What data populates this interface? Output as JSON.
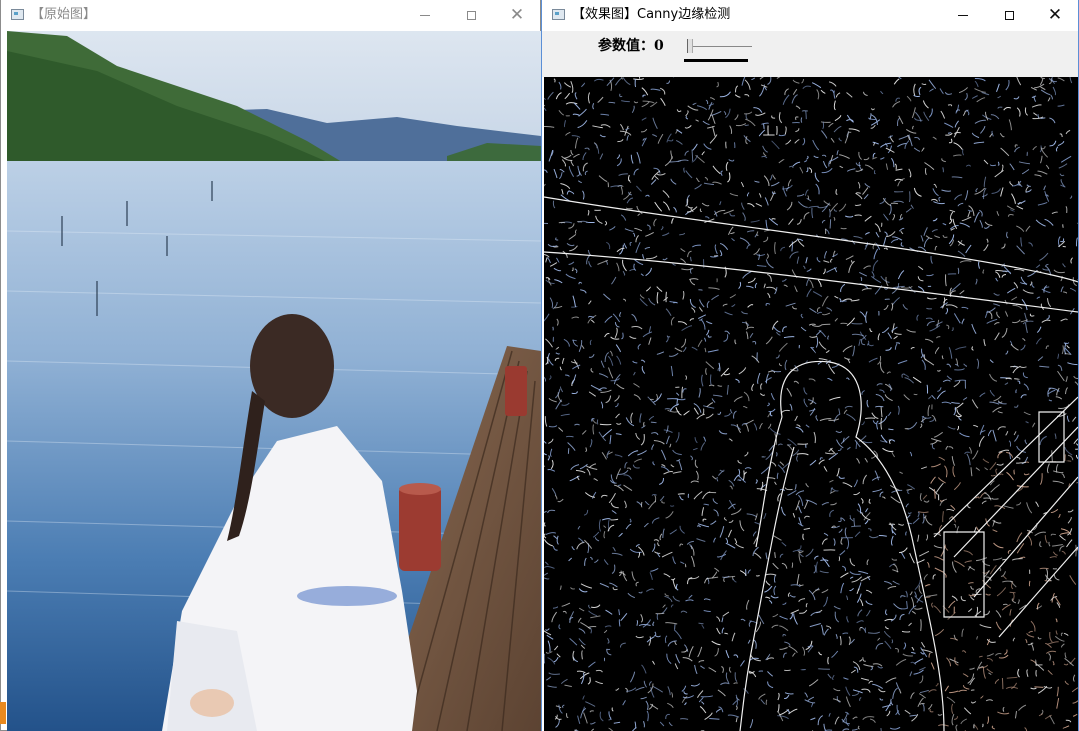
{
  "windows": {
    "original": {
      "title": "【原始图】",
      "image_description": "girl in white dress sitting on wooden pier by a lake"
    },
    "result": {
      "title": "【效果图】Canny边缘检测",
      "trackbar": {
        "label": "参数值：",
        "value": "0"
      }
    }
  },
  "colors": {
    "titlebar": "#ffffff",
    "active_border": "#5b8fd6",
    "trackbar_panel": "#f0f0f0",
    "edge_background": "#000000"
  }
}
